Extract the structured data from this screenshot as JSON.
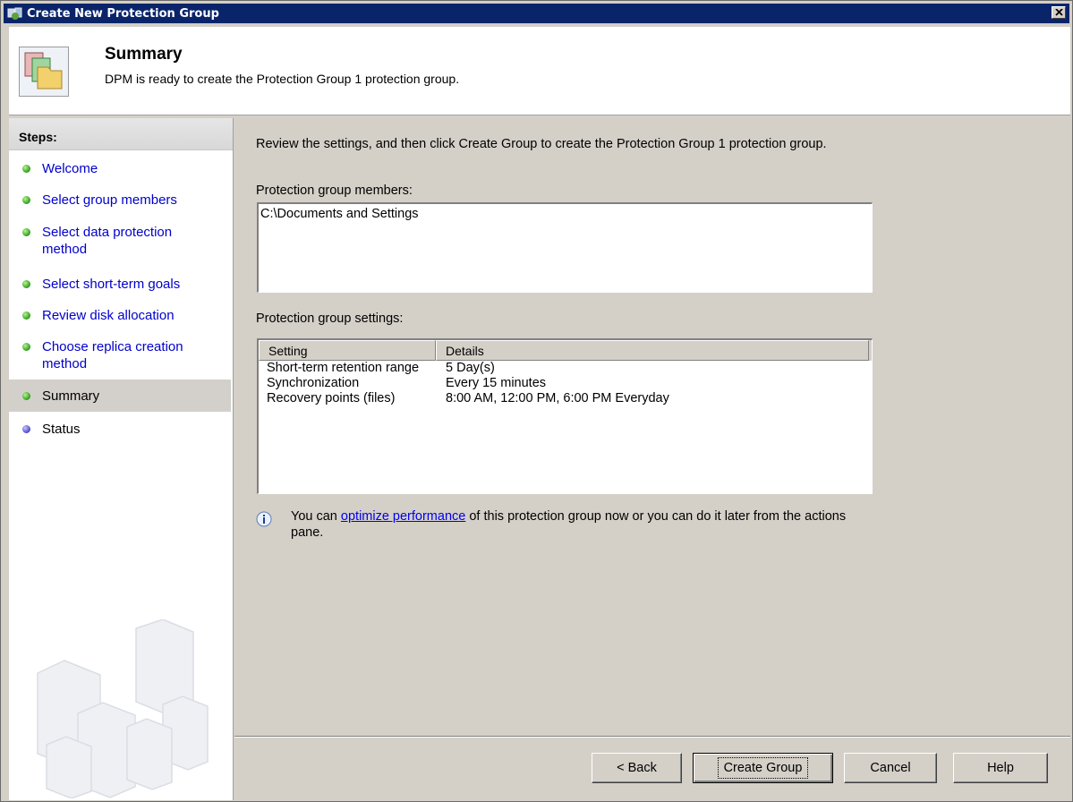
{
  "window": {
    "title": "Create New Protection Group"
  },
  "header": {
    "title": "Summary",
    "description": "DPM is ready to create the Protection Group 1 protection group."
  },
  "steps": {
    "heading": "Steps:",
    "items": [
      {
        "label": "Welcome",
        "state": "done"
      },
      {
        "label": "Select group members",
        "state": "done"
      },
      {
        "label": "Select data protection method",
        "state": "done"
      },
      {
        "label": "Select short-term goals",
        "state": "done"
      },
      {
        "label": "Review disk allocation",
        "state": "done"
      },
      {
        "label": "Choose replica creation method",
        "state": "done"
      },
      {
        "label": "Summary",
        "state": "current"
      },
      {
        "label": "Status",
        "state": "pending"
      }
    ]
  },
  "main": {
    "intro": "Review the settings, and then click Create Group to create the Protection Group 1 protection group.",
    "members_label": "Protection group members:",
    "members": [
      "C:\\Documents and Settings"
    ],
    "settings_label": "Protection group settings:",
    "settings_columns": [
      "Setting",
      "Details"
    ],
    "settings_rows": [
      {
        "setting": "Short-term retention range",
        "details": "5 Day(s)"
      },
      {
        "setting": "Synchronization",
        "details": "Every 15 minutes"
      },
      {
        "setting": "Recovery points (files)",
        "details": "8:00 AM, 12:00 PM, 6:00 PM Everyday"
      }
    ],
    "info": {
      "prefix": "You can ",
      "link": "optimize performance",
      "suffix": " of this protection group now or you can do it later from the actions pane."
    }
  },
  "buttons": {
    "back": "< Back",
    "create": "Create Group",
    "cancel": "Cancel",
    "help": "Help"
  }
}
